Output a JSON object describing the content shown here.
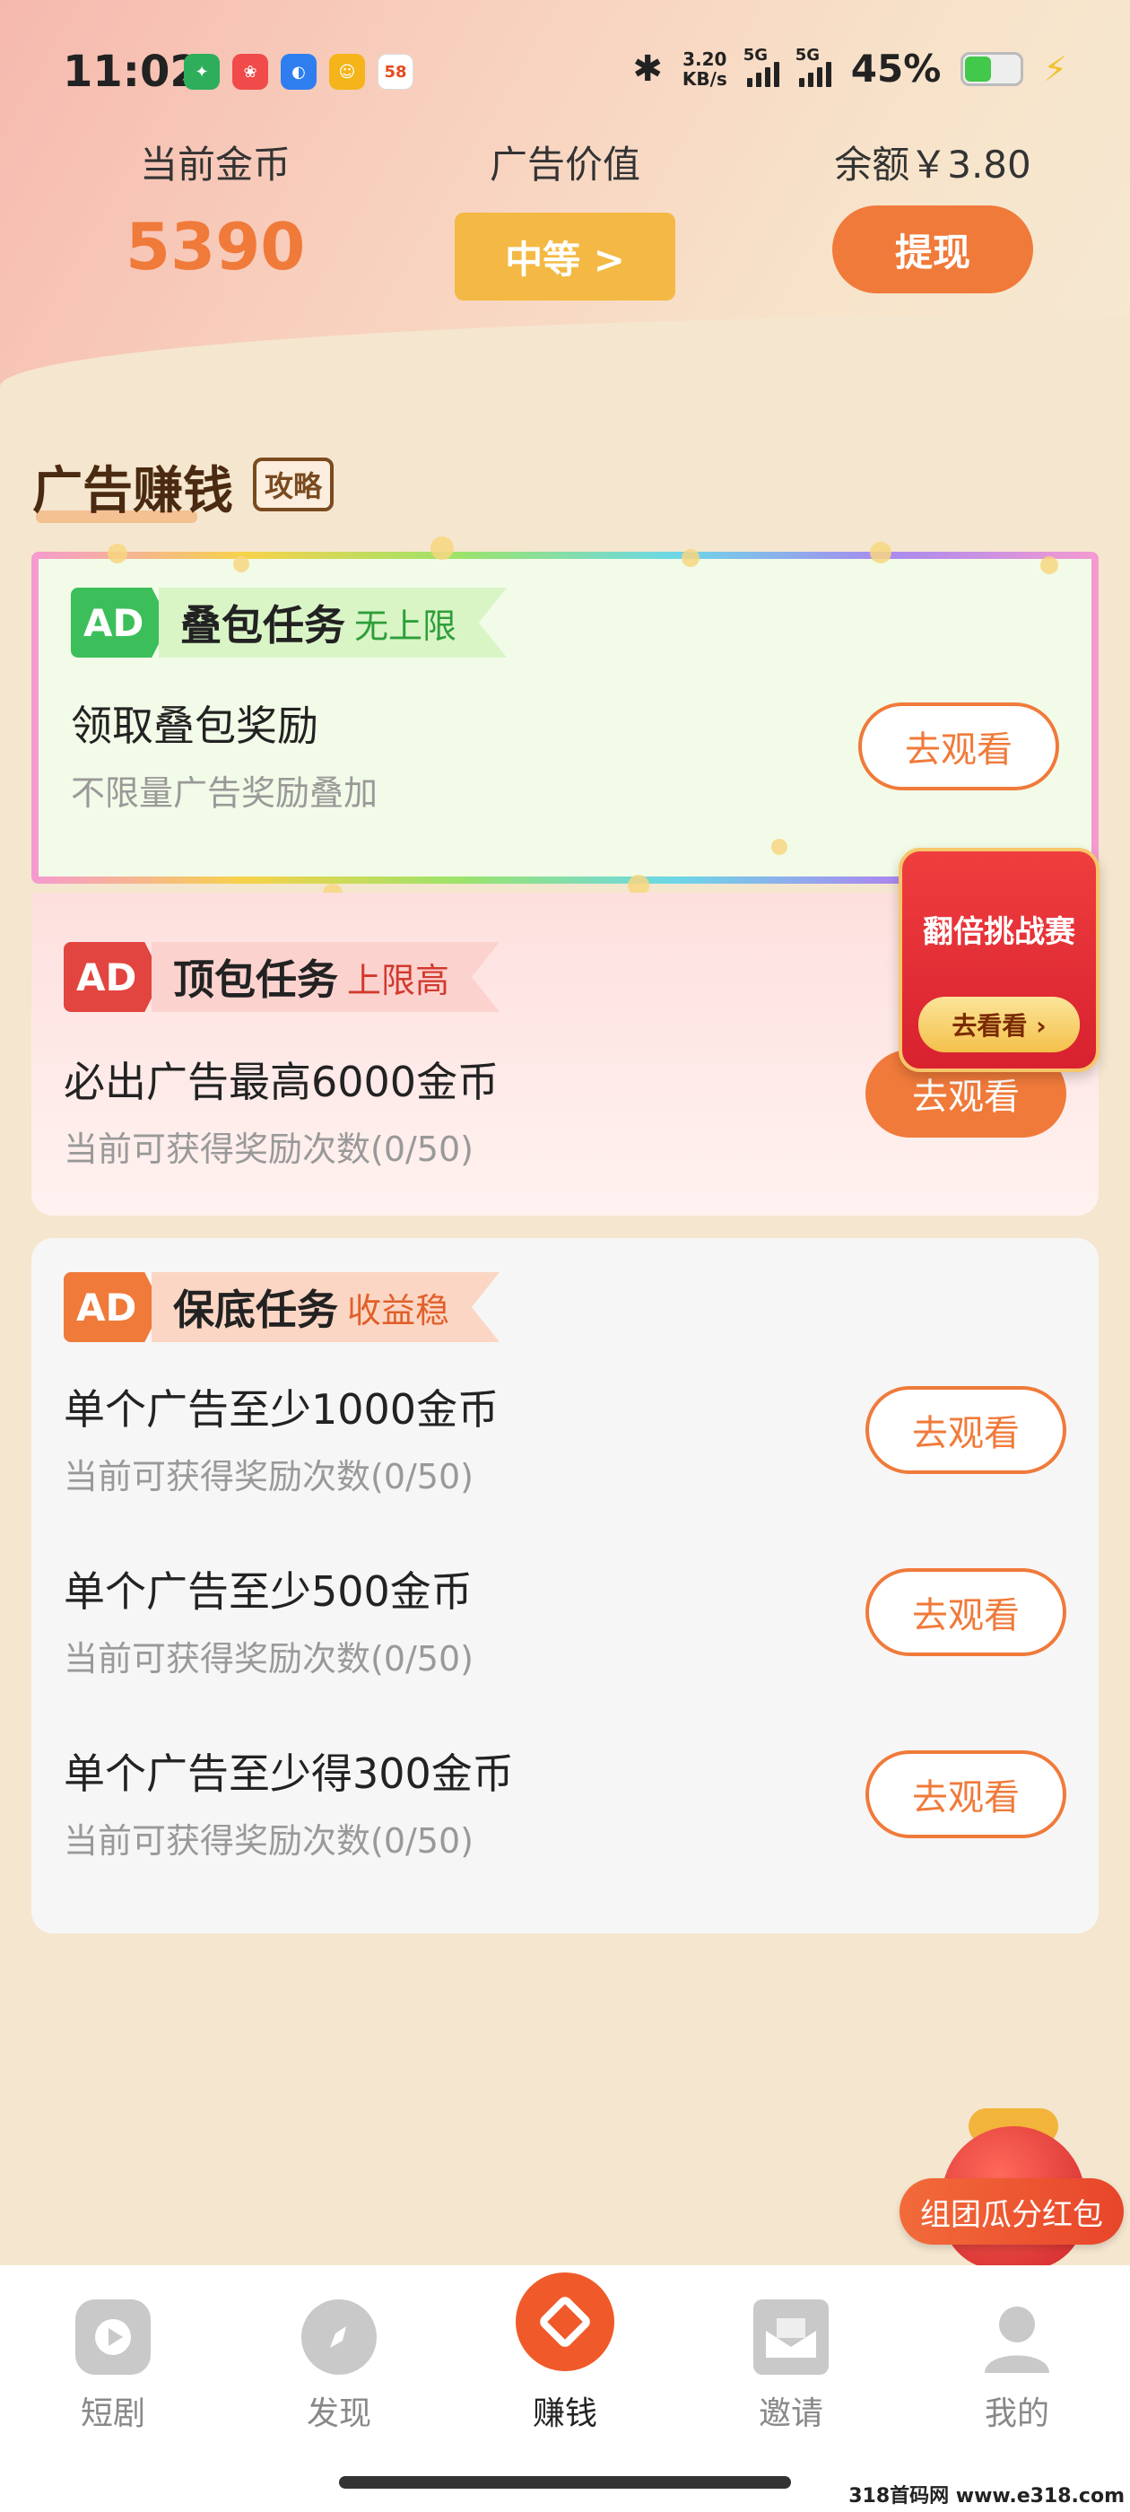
{
  "status": {
    "time": "11:02",
    "net_speed_value": "3.20",
    "net_speed_unit": "KB/s",
    "signal1_label": "5G",
    "signal2_label": "5G",
    "battery": "45%",
    "app_icons": [
      "app-icon-1",
      "app-icon-2",
      "app-icon-3",
      "app-icon-4",
      "58"
    ]
  },
  "header": {
    "coins_label": "当前金币",
    "coins_value": "5390",
    "ad_value_label": "广告价值",
    "ad_value_button": "中等 >",
    "balance_label": "余额￥3.80",
    "withdraw_button": "提现"
  },
  "section": {
    "title": "广告赚钱",
    "guide_tag": "攻略"
  },
  "stack_task": {
    "badge": "AD",
    "title": "叠包任务",
    "subtitle": "无上限",
    "row_title": "领取叠包奖励",
    "row_desc": "不限量广告奖励叠加",
    "button": "去观看"
  },
  "top_task": {
    "badge": "AD",
    "title": "顶包任务",
    "subtitle": "上限高",
    "row_title": "必出广告最高6000金币",
    "row_desc": "当前可获得奖励次数(0/50)",
    "button": "去观看"
  },
  "base_task": {
    "badge": "AD",
    "title": "保底任务",
    "subtitle": "收益稳",
    "rows": [
      {
        "title": "单个广告至少1000金币",
        "desc": "当前可获得奖励次数(0/50)",
        "button": "去观看"
      },
      {
        "title": "单个广告至少500金币",
        "desc": "当前可获得奖励次数(0/50)",
        "button": "去观看"
      },
      {
        "title": "单个广告至少得300金币",
        "desc": "当前可获得奖励次数(0/50)",
        "button": "去观看"
      }
    ]
  },
  "promo": {
    "title": "翻倍挑战赛",
    "button": "去看看 ›"
  },
  "red_packet": {
    "label": "组团瓜分红包"
  },
  "nav": [
    {
      "label": "短剧",
      "icon": "play-icon"
    },
    {
      "label": "发现",
      "icon": "compass-icon"
    },
    {
      "label": "赚钱",
      "icon": "earn-icon"
    },
    {
      "label": "邀请",
      "icon": "envelope-icon"
    },
    {
      "label": "我的",
      "icon": "profile-icon"
    }
  ],
  "watermark": "318首码网 www.e318.com",
  "colors": {
    "accent": "#f07a3a",
    "gold": "#f4b944",
    "background": "#f5e6cf",
    "green_badge": "#3cbf5a",
    "red_badge": "#e2453f",
    "orange_badge": "#f07a3a"
  }
}
